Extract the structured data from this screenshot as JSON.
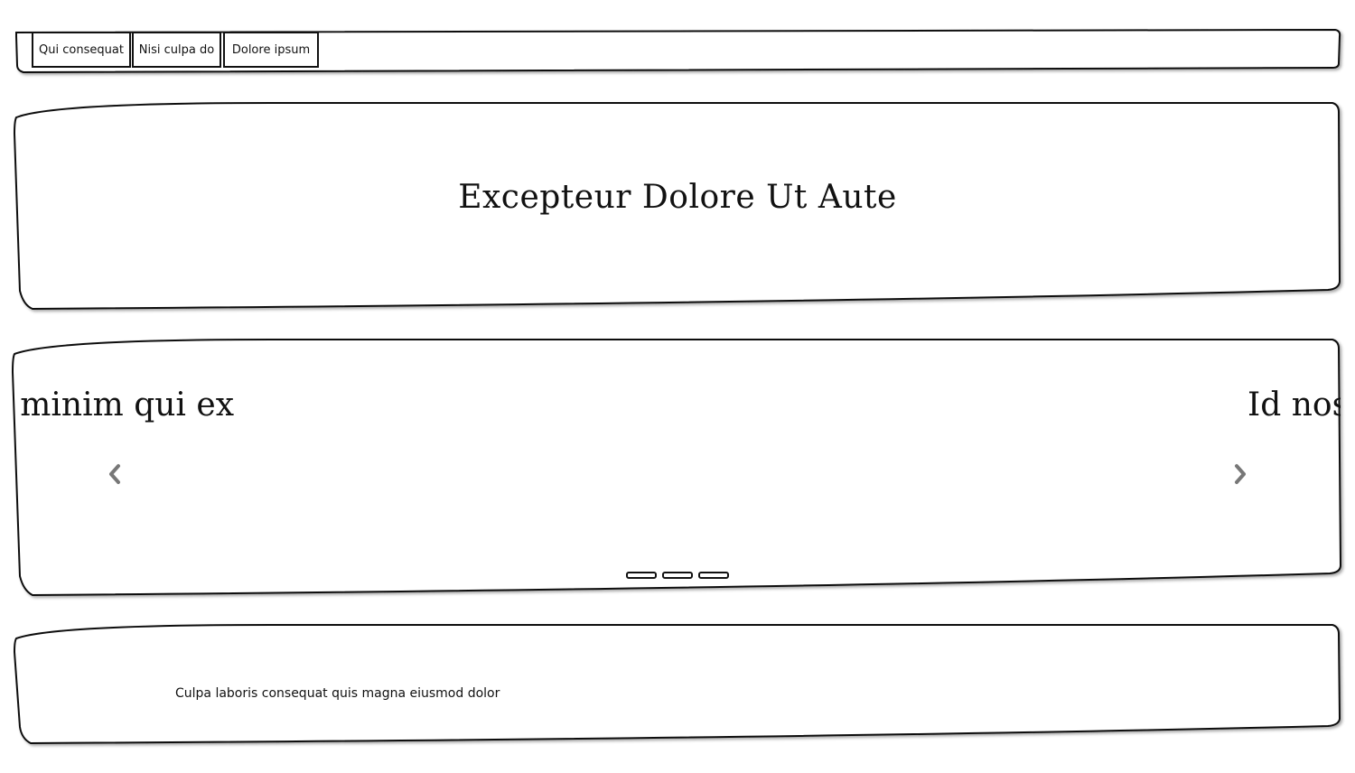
{
  "nav": {
    "items": [
      {
        "label": "Qui consequat"
      },
      {
        "label": "Nisi culpa do"
      },
      {
        "label": "Dolore ipsum"
      }
    ]
  },
  "hero": {
    "title": "Excepteur Dolore Ut Aute"
  },
  "carousel": {
    "prev_slide_text": "a minim qui ex",
    "next_slide_text": "Id nos",
    "prev_icon": "chevron-left-icon",
    "next_icon": "chevron-right-icon",
    "indicator_count": 3
  },
  "footer": {
    "text": "Culpa laboris consequat quis magna eiusmod dolor"
  },
  "colors": {
    "stroke": "#111111",
    "arrow": "#777777",
    "background": "#ffffff"
  }
}
